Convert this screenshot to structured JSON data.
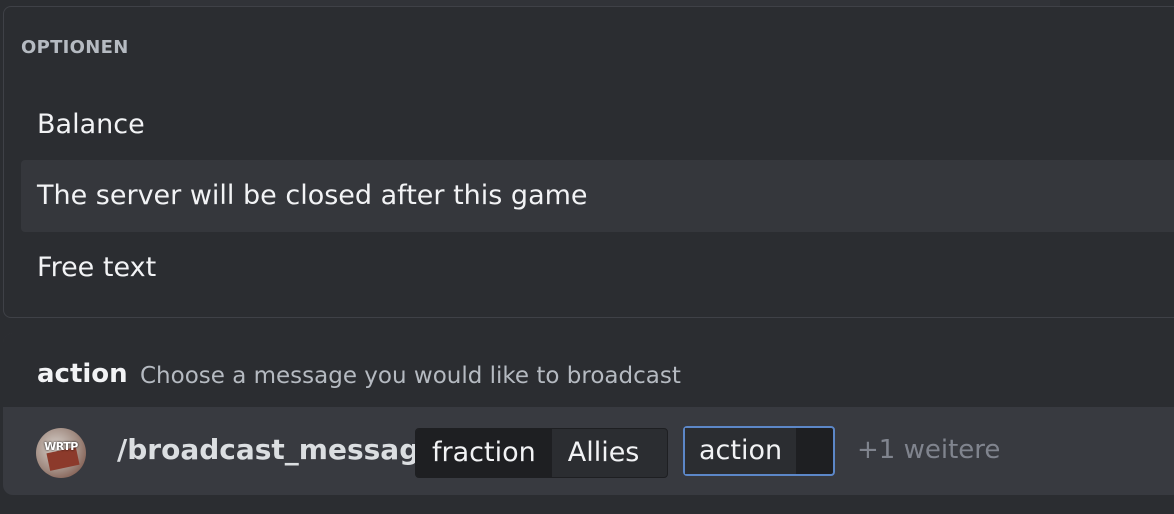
{
  "options": {
    "header": "OPTIONEN",
    "items": [
      {
        "label": "Balance"
      },
      {
        "label": "The server will be closed after this game"
      },
      {
        "label": "Free text"
      }
    ]
  },
  "hint": {
    "name": "action",
    "description": "Choose a message you would like to broadcast"
  },
  "command": {
    "name": "/broadcast_message",
    "avatar_text": "WRTP",
    "params": [
      {
        "name": "fraction",
        "value": "Allies"
      },
      {
        "name": "action",
        "value": ""
      }
    ],
    "more": "+1 weitere"
  },
  "colors": {
    "background": "#2b2d31",
    "selected_item": "#35373c",
    "focus_border": "#5c87c8"
  }
}
